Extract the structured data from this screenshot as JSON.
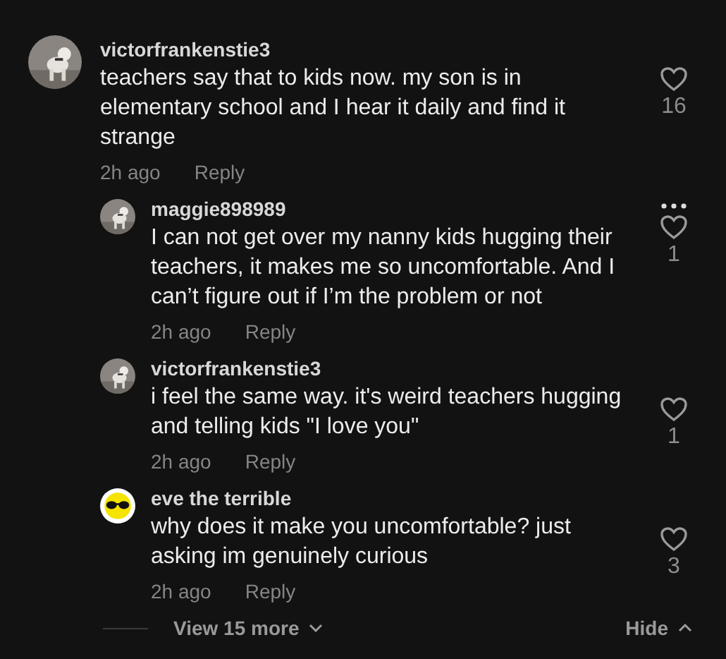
{
  "comment": {
    "username": "victorfrankenstie3",
    "text": "teachers say that to kids now. my son is in elementary school and I hear it daily and find it strange",
    "time": "2h ago",
    "reply_label": "Reply",
    "likes": "16",
    "liked": false
  },
  "replies": [
    {
      "username": "maggie898989",
      "text": "I can not get over my nanny kids hugging their teachers, it makes me so uncomfortable. And I can’t figure out if I’m the problem or not",
      "time": "2h ago",
      "reply_label": "Reply",
      "likes": "1",
      "liked": false,
      "more_button": true
    },
    {
      "username": "victorfrankenstie3",
      "text": "i feel the same way. it's weird teachers hugging and telling kids \"I love you\"",
      "time": "2h ago",
      "reply_label": "Reply",
      "likes": "1",
      "liked": false,
      "more_button": false
    },
    {
      "username": "eve the terrible",
      "avatar": {
        "kind": "sunglasses"
      },
      "text": "why does it make you uncomfortable? just asking im genuinely curious",
      "time": "2h ago",
      "reply_label": "Reply",
      "likes": "3",
      "liked": false,
      "more_button": false
    }
  ],
  "footer": {
    "view_more": "View 15 more",
    "hide": "Hide"
  }
}
